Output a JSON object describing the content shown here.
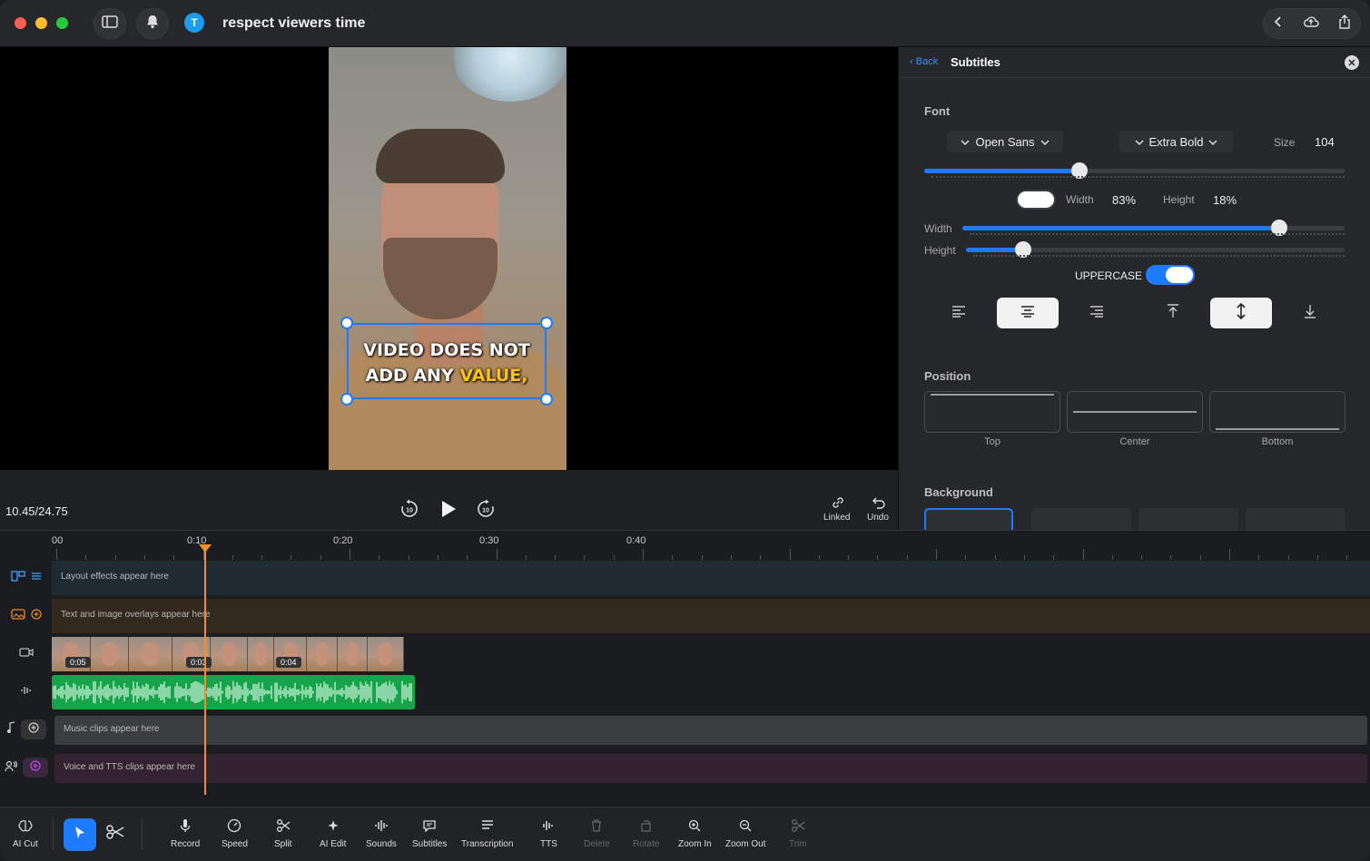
{
  "window": {
    "title": "respect viewers time",
    "avatar_letter": "T"
  },
  "colors": {
    "accent": "#1e7bff",
    "playhead": "#f0902a",
    "audio": "#16a34a",
    "highlight": "#ffc21a"
  },
  "preview": {
    "subtitle_line1": "VIDEO DOES NOT",
    "subtitle_line2_a": "ADD ANY ",
    "subtitle_line2_b": "VALUE,"
  },
  "playback": {
    "timecode": "10.45/24.75",
    "linked_label": "Linked",
    "undo_label": "Undo",
    "skip_back": "10",
    "skip_fwd": "10"
  },
  "panel": {
    "back": "Back",
    "title": "Subtitles",
    "font": {
      "label": "Font",
      "family": "Open Sans",
      "weight": "Extra Bold",
      "size_label": "Size",
      "size": "104",
      "size_slider": 0.37
    },
    "box": {
      "width_label": "Width",
      "width_value": "83%",
      "height_label": "Height",
      "height_value": "18%",
      "width_slider": 0.83,
      "height_slider": 0.15
    },
    "uppercase": {
      "label": "UPPERCASE",
      "on": true
    },
    "position": {
      "label": "Position",
      "options": [
        "Top",
        "Center",
        "Bottom"
      ]
    },
    "background": {
      "label": "Background"
    }
  },
  "timeline": {
    "ruler": [
      "00",
      "0:10",
      "0:20",
      "0:30",
      "0:40"
    ],
    "layout_track": "Layout effects appear here",
    "overlay_track": "Text and image overlays appear here",
    "clip_badges": [
      "0:05",
      "0:03",
      "0:04"
    ],
    "music_track": "Music clips appear here",
    "voice_track": "Voice and TTS clips appear here"
  },
  "toolbar": {
    "ai_cut": "AI Cut",
    "tools": [
      "Record",
      "Speed",
      "Split",
      "AI Edit",
      "Sounds",
      "Subtitles",
      "Transcription",
      "TTS",
      "Delete",
      "Rotate",
      "Zoom In",
      "Zoom Out",
      "Trim"
    ]
  }
}
